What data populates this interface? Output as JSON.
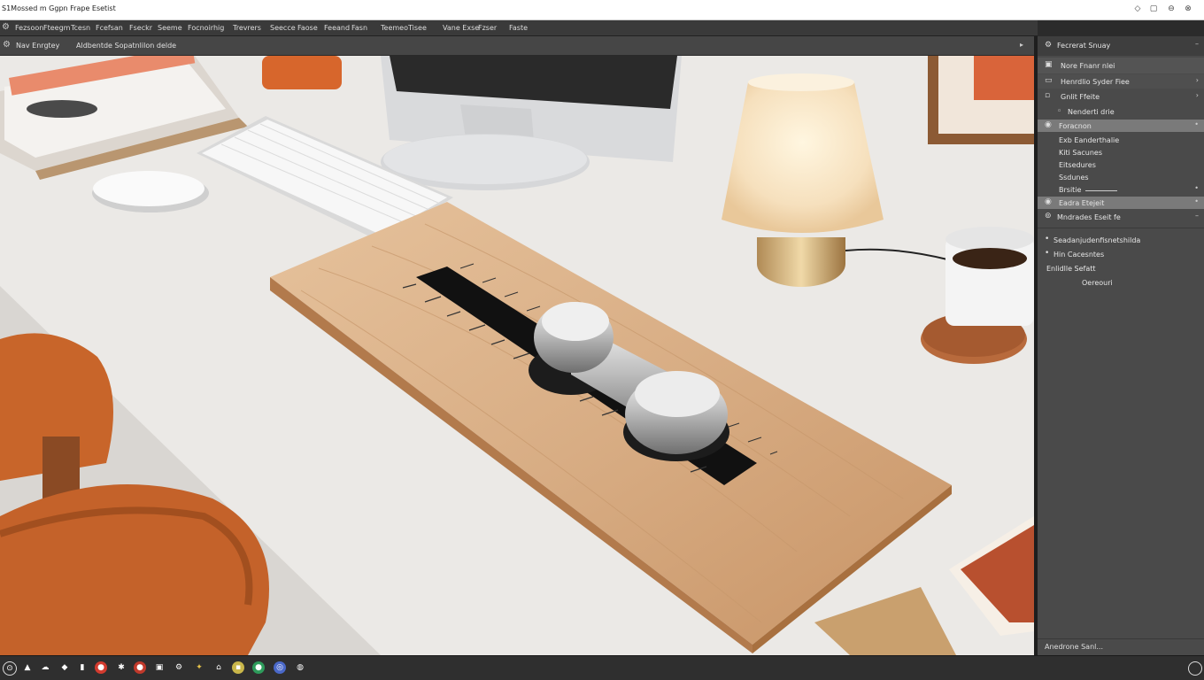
{
  "window": {
    "title": "S1Mossed m Ggpn Frape Esetist",
    "controls": [
      "diamond-icon",
      "restore-icon",
      "minimize-icon",
      "close-icon"
    ]
  },
  "menubar": {
    "items": [
      "Fezsoon",
      "Fteegm",
      "Tcesn",
      "Fcefsan",
      "Fseckr",
      "Seeme",
      "Focnoirhig",
      "Trevrers",
      "Seecce",
      "Faose",
      "Feeand",
      "Fasn",
      "Teemeo",
      "Tisee",
      "Vane Exse",
      "Fzser",
      "Faste"
    ]
  },
  "toolbar": {
    "mode_label": "Nav Enrgtey",
    "hint_label": "Aldbentde Sopatnlilon delde"
  },
  "panel": {
    "header": "Fecrerat Snuay",
    "row1": "Nore Fnanr nlei",
    "row2": "Henrdlio Syder Fiee",
    "row3": "Gnlit Ffeite",
    "row4": "Nenderti drie",
    "row5_selected": "Foracnon",
    "sub1": "Exb Eanderthalie",
    "sub2": "Kiti Sacunes",
    "sub3": "Eitsedures",
    "sub4": "Ssdunes",
    "sub5": "Brsitie",
    "row6_selected": "Eadra Etejeit",
    "row7": "Mndrades Eseit fe",
    "list1": "Seadanjudenfisnetshilda",
    "list2": "Hin Cacesntes",
    "list3": "Enlidlle Sefatt",
    "list4": "Oereouri",
    "status": "Anedrone Sanl..."
  },
  "colors": {
    "desk": "#e8e6e3",
    "wood": "#dcb48c",
    "chair": "#c8652a",
    "panel_selected": "#7a7a7a"
  }
}
